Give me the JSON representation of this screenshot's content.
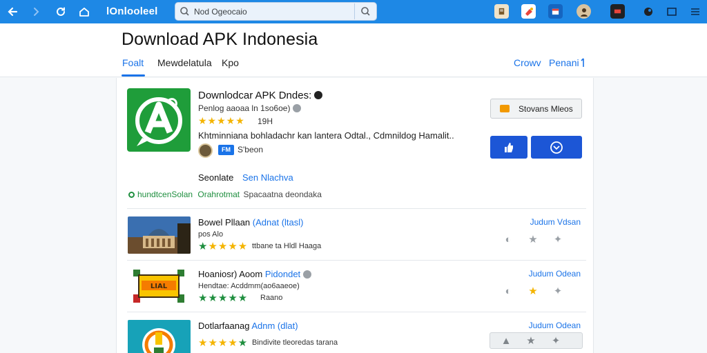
{
  "browser": {
    "site_title": "lOnlooleel",
    "url": "Nod Ogeocaio"
  },
  "header": {
    "title": "Download APK Indonesia",
    "tabs": [
      {
        "label": "Foalt",
        "active": true
      },
      {
        "label": "Mewdelatula",
        "active": false
      },
      {
        "label": "Kpo",
        "active": false
      }
    ],
    "links": [
      "Crowv",
      "Penani"
    ]
  },
  "app": {
    "name": "Downlodcar APK Dndes:",
    "meta": "Penlog aaoaa ln 1so6oe)",
    "rating_value": "19H",
    "stars": 5,
    "description": "Khtminniana bohladachr kan lantera Odtal., Cdmnildog Hamalit..",
    "developer_badge": "FM",
    "developer_name": "S'beon",
    "wishlist_label": "Stovans Mleos",
    "sub_label": "Seonlate",
    "sub_link": "Sen Nlachva",
    "tags": {
      "green_a": "hundtcenSolan",
      "green_b": "Orahrotmat",
      "grey": "Spacaatna deondaka"
    }
  },
  "items": [
    {
      "title": "Bowel Pllaan",
      "title_link": "(Adnat (ltasl)",
      "sub": "pos Alo",
      "after_stars": "ttbane ta Hldl Haaga",
      "link": "Judum Vdsan",
      "stars": 5
    },
    {
      "title": "Hoaniosr) Aoom",
      "title_link": "Pidondet",
      "sub": "Hendtae: Acddmm(ao6aaeoe)",
      "after_stars": "Raano",
      "link": "Judum Odean",
      "stars": 5
    },
    {
      "title": "Dotlarfaanag",
      "title_link": "Adnm (dlat)",
      "sub": "",
      "after_stars": "Bindivite tleoredas tarana",
      "link": "Judum Odean",
      "stars": 5
    }
  ],
  "colors": {
    "browser_bar": "#1e88e5",
    "accent": "#1a73e8",
    "app_logo": "#1f9d3a",
    "primary_button": "#1c56d6",
    "star": "#f4b400",
    "green_tag": "#1e8e3e"
  }
}
